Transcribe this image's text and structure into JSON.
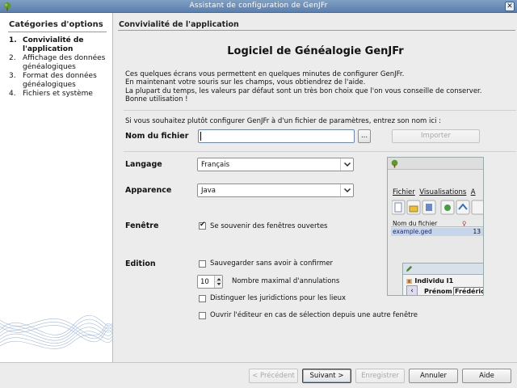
{
  "window": {
    "title": "Assistant de configuration de GenJFr",
    "app_icon": "genjfr-tree-icon",
    "close_glyph": "✕"
  },
  "sidebar": {
    "header": "Catégories d'options",
    "items": [
      {
        "num": "1.",
        "label": "Convivialité de l'application",
        "active": true
      },
      {
        "num": "2.",
        "label": "Affichage des données généalogiques",
        "active": false
      },
      {
        "num": "3.",
        "label": "Format des données généalogiques",
        "active": false
      },
      {
        "num": "4.",
        "label": "Fichiers et système",
        "active": false
      }
    ]
  },
  "main": {
    "section_title": "Convivialité de l'application",
    "big_title": "Logiciel de Généalogie GenJFr",
    "intro": [
      "Ces quelques écrans vous permettent en quelques minutes de configurer GenJFr.",
      "En maintenant votre souris sur les champs, vous obtiendrez de l'aide.",
      "La plupart du temps, les valeurs par défaut sont un très bon choix que l'on vous conseille de conserver.",
      "Bonne utilisation !"
    ],
    "question": "Si vous souhaitez plutôt configurer GenJFr à d'un fichier de paramètres, entrez son nom ici :",
    "file": {
      "label": "Nom du fichier",
      "value": "",
      "browse_label": "...",
      "import_label": "Importer"
    },
    "language": {
      "label": "Langage",
      "value": "Français"
    },
    "appearance": {
      "label": "Apparence",
      "value": "Java"
    },
    "window_opts": {
      "label": "Fenêtre",
      "remember_label": "Se souvenir des fenêtres ouvertes",
      "remember_checked": true
    },
    "edition": {
      "label": "Edition",
      "save_label": "Sauvegarder sans avoir à confirmer",
      "save_checked": false,
      "undo_value": "10",
      "undo_label": "Nombre maximal d'annulations",
      "jurisdictions_label": "Distinguer les juridictions pour les lieux",
      "jurisdictions_checked": false,
      "open_editor_label": "Ouvrir l'éditeur en cas de sélection depuis une autre fenêtre",
      "open_editor_checked": false
    },
    "preview": {
      "menu": [
        "Fichier",
        "Visualisations",
        "A"
      ],
      "table_header": "Nom du fichier",
      "file_name": "example.ged",
      "file_count": "13",
      "sub_title": "Individu I1",
      "sub_field_label": "Prénom",
      "sub_field_value": "Frédéric"
    }
  },
  "footer": {
    "prev": "< Précédent",
    "next": "Suivant >",
    "save": "Enregistrer",
    "cancel": "Annuler",
    "help": "Aide"
  },
  "colors": {
    "titlebar": "#6b8cb8",
    "preview_accent": "#4a7a2a",
    "selection": "#c7d5ea"
  }
}
